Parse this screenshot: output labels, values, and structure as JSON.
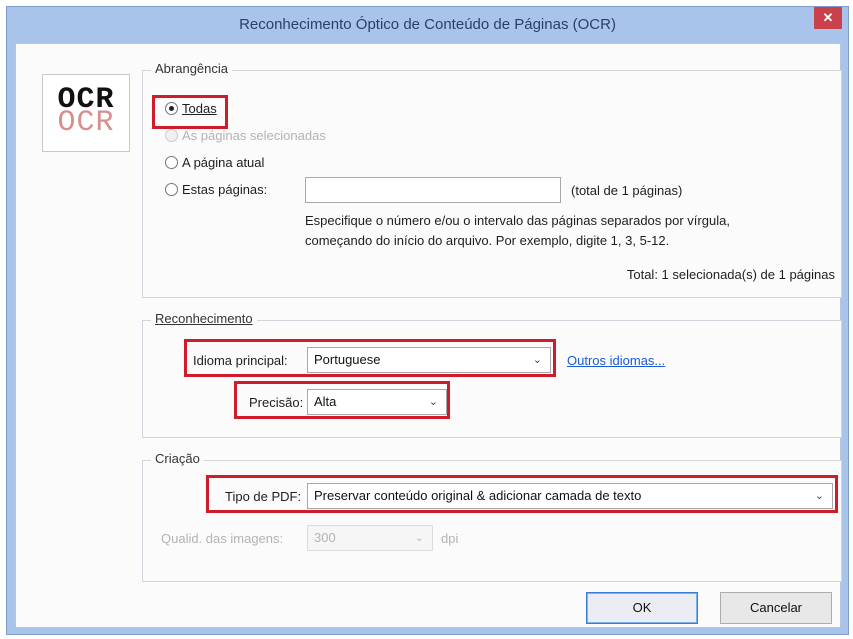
{
  "window": {
    "title": "Reconhecimento Óptico de Conteúdo de Páginas (OCR)",
    "close_glyph": "✕"
  },
  "logo": {
    "text": "OCR"
  },
  "scope": {
    "legend": "Abrangência",
    "all_label": "Todas",
    "selected_label": "As páginas selecionadas",
    "current_label": "A página atual",
    "these_label": "Estas páginas:",
    "pages_input_value": "",
    "pages_total": "(total de 1 páginas)",
    "help_line1": "Especifique o número e/ou o intervalo das páginas separados por vírgula,",
    "help_line2": "começando do início do arquivo. Por exemplo, digite 1, 3, 5-12.",
    "summary": "Total: 1 selecionada(s) de 1 páginas",
    "selected_option": "Todas"
  },
  "recognition": {
    "legend": "Reconhecimento",
    "language_label": "Idioma principal:",
    "language_value": "Portuguese",
    "other_languages_link": "Outros idiomas...",
    "precision_label": "Precisão:",
    "precision_value": "Alta"
  },
  "creation": {
    "legend": "Criação",
    "pdf_type_label": "Tipo de PDF:",
    "pdf_type_value": "Preservar conteúdo original & adicionar camada de texto",
    "image_quality_label": "Qualid. das imagens:",
    "image_quality_value": "300",
    "image_quality_unit": "dpi"
  },
  "buttons": {
    "ok": "OK",
    "cancel": "Cancelar"
  },
  "icons": {
    "dropdown": "chevron-down-icon",
    "close": "close-icon"
  },
  "colors": {
    "highlight": "#d01c2a",
    "titlebar": "#a9c4ea",
    "close": "#c8414b",
    "link": "#1a5bd4"
  }
}
